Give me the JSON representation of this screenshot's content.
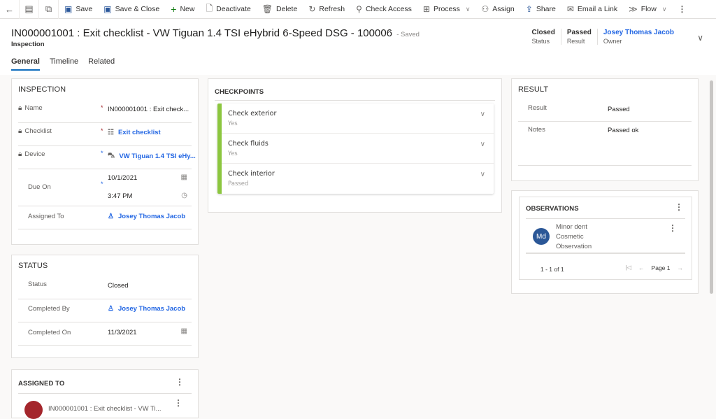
{
  "commandbar": {
    "back_icon": "back-arrow-icon",
    "items": [
      {
        "label": "Save",
        "icon": "save-icon"
      },
      {
        "label": "Save & Close",
        "icon": "save-close-icon"
      },
      {
        "label": "New",
        "icon": "plus-icon"
      },
      {
        "label": "Deactivate",
        "icon": "deactivate-icon"
      },
      {
        "label": "Delete",
        "icon": "trash-icon"
      },
      {
        "label": "Refresh",
        "icon": "refresh-icon"
      },
      {
        "label": "Check Access",
        "icon": "key-icon"
      },
      {
        "label": "Process",
        "icon": "process-icon"
      },
      {
        "label": "Assign",
        "icon": "assign-icon"
      },
      {
        "label": "Share",
        "icon": "share-icon"
      },
      {
        "label": "Email a Link",
        "icon": "email-icon"
      },
      {
        "label": "Flow",
        "icon": "flow-icon"
      }
    ]
  },
  "header": {
    "title": "IN000001001 : Exit checklist - VW Tiguan 1.4 TSI eHybrid 6-Speed DSG - 100006",
    "save_status": "- Saved",
    "entity": "Inspection",
    "fields": [
      {
        "value": "Closed",
        "label": "Status"
      },
      {
        "value": "Passed",
        "label": "Result"
      },
      {
        "value": "Josey Thomas Jacob",
        "label": "Owner"
      }
    ]
  },
  "tabs": [
    {
      "label": "General",
      "active": true
    },
    {
      "label": "Timeline",
      "active": false
    },
    {
      "label": "Related",
      "active": false
    }
  ],
  "inspection": {
    "title": "INSPECTION",
    "name_label": "Name",
    "name_value": "IN000001001 : Exit check...",
    "checklist_label": "Checklist",
    "checklist_value": "Exit checklist",
    "device_label": "Device",
    "device_value": "VW Tiguan 1.4 TSI eHy...",
    "due_label": "Due On",
    "due_date": "10/1/2021",
    "due_time": "3:47 PM",
    "assigned_label": "Assigned To",
    "assigned_value": "Josey Thomas Jacob",
    "required_mark": "*"
  },
  "status": {
    "title": "STATUS",
    "status_label": "Status",
    "status_value": "Closed",
    "completed_by_label": "Completed By",
    "completed_by_value": "Josey Thomas Jacob",
    "completed_on_label": "Completed On",
    "completed_on_value": "11/3/2021"
  },
  "assigned_to": {
    "title": "ASSIGNED TO",
    "item_text": "IN000001001 : Exit checklist - VW Ti..."
  },
  "checkpoints": {
    "title": "CHECKPOINTS",
    "accent": "#8cc63f",
    "items": [
      {
        "name": "Check exterior",
        "value": "Yes"
      },
      {
        "name": "Check fluids",
        "value": "Yes"
      },
      {
        "name": "Check interior",
        "value": "Passed"
      }
    ]
  },
  "result": {
    "title": "RESULT",
    "result_label": "Result",
    "result_value": "Passed",
    "notes_label": "Notes",
    "notes_value": "Passed ok"
  },
  "observations": {
    "title": "OBSERVATIONS",
    "item": {
      "initials": "Md",
      "line1": "Minor dent",
      "line2": "Cosmetic",
      "line3": "Observation"
    },
    "count": "1 - 1 of 1",
    "page": "Page 1"
  }
}
